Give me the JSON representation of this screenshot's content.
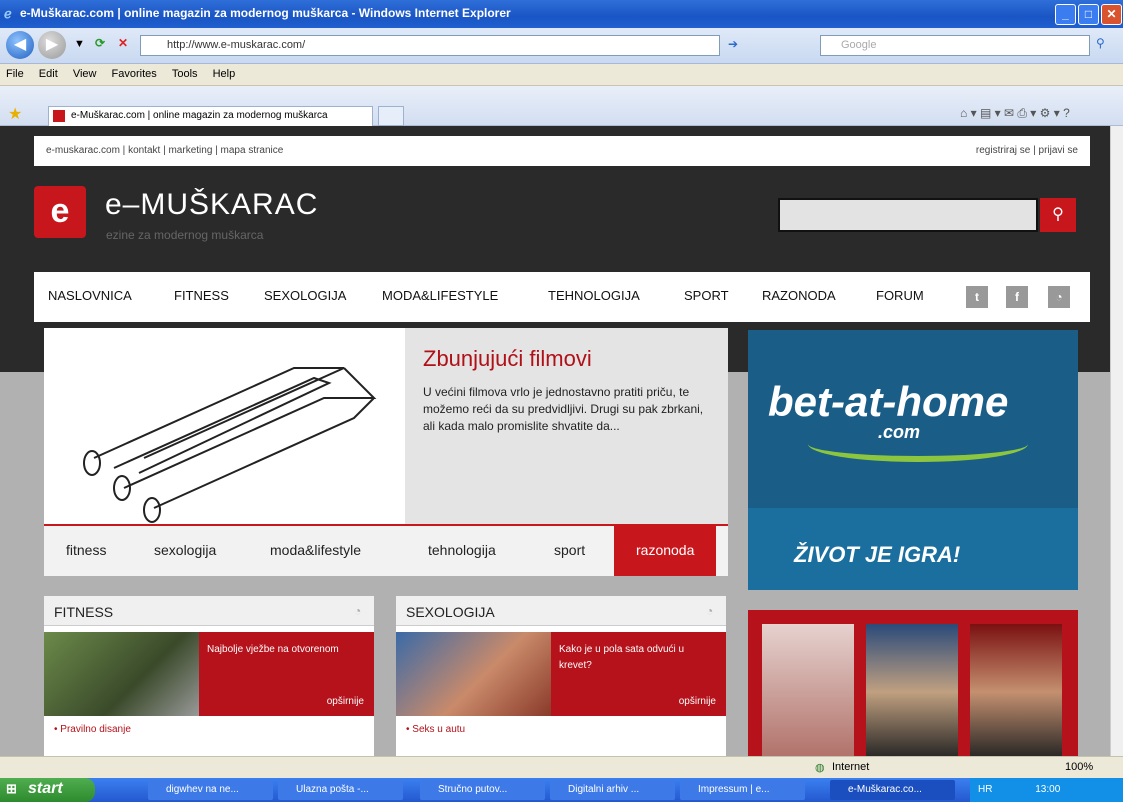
{
  "window": {
    "title": "e-Muškarac.com | online magazin za modernog muškarca - Windows Internet Explorer"
  },
  "browser": {
    "address": "http://www.e-muskarac.com/",
    "search_placeholder": "Google",
    "menu": [
      "File",
      "Edit",
      "View",
      "Favorites",
      "Tools",
      "Help"
    ],
    "tab_title": "e-Muškarac.com | online magazin za modernog muškarca"
  },
  "site": {
    "topnav": [
      "e-muskarac.com",
      "kontakt",
      "marketing",
      "mapa stranice"
    ],
    "topnav_right": [
      "registriraj se",
      "prijavi se"
    ],
    "logo_text": "e–MUŠKARAC",
    "tagline": "ezine za modernog muškarca",
    "mainnav": [
      "NASLOVNICA",
      "FITNESS",
      "SEXOLOGIJA",
      "MODA&LIFESTYLE",
      "TEHNOLOGIJA",
      "SPORT",
      "RAZONODA",
      "FORUM"
    ],
    "social_icons": [
      "twitter-icon",
      "facebook-icon",
      "rss-icon"
    ],
    "featured": {
      "title": "Zbunjujući filmovi",
      "text": "U većini filmova vrlo je jednostavno pratiti priču, te možemo reći da su predvidljivi. Drugi su pak zbrkani, ali kada malo promislite shvatite da..."
    },
    "category_tabs": [
      "fitness",
      "sexologija",
      "moda&lifestyle",
      "tehnologija",
      "sport",
      "razonoda"
    ],
    "active_tab": "razonoda",
    "ad": {
      "logo": "bet-at-home",
      "domain": ".com",
      "slogan": "ŽIVOT JE IGRA!"
    },
    "boxes": [
      {
        "title": "FITNESS",
        "headline": "Najbolje vježbe na otvorenom",
        "more": "opširnije",
        "list_item": "Pravilno disanje"
      },
      {
        "title": "SEXOLOGIJA",
        "headline": "Kako je u pola sata odvući u krevet?",
        "more": "opširnije",
        "list_item": "Seks u autu"
      }
    ]
  },
  "statusbar": {
    "zone": "Internet",
    "zoom": "100%"
  },
  "taskbar": {
    "start": "start",
    "tasks": [
      "digwhev na ne...",
      "Ulazna pošta -...",
      "Stručno putov...",
      "Digitalni arhiv ...",
      "Impressum | e...",
      "e-Muškarac.co..."
    ],
    "lang": "HR",
    "clock": "13:00"
  },
  "colors": {
    "brand_red": "#c8161d",
    "ad_blue": "#1a5e88",
    "ad_green": "#8cc63f"
  }
}
